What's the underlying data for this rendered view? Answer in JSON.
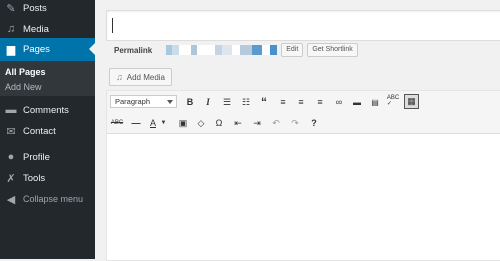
{
  "sidebar": {
    "items": [
      {
        "label": "Posts",
        "icon": "pin-icon"
      },
      {
        "label": "Media",
        "icon": "media-icon"
      },
      {
        "label": "Pages",
        "icon": "pages-icon"
      },
      {
        "label": "Comments",
        "icon": "comments-icon"
      },
      {
        "label": "Contact",
        "icon": "mail-icon"
      },
      {
        "label": "Profile",
        "icon": "user-icon"
      },
      {
        "label": "Tools",
        "icon": "wrench-icon"
      },
      {
        "label": "Collapse menu",
        "icon": "collapse-icon"
      }
    ],
    "submenu": [
      {
        "label": "All Pages"
      },
      {
        "label": "Add New"
      }
    ]
  },
  "editor": {
    "permalink_label": "Permalink",
    "edit_label": "Edit",
    "shortlink_label": "Get Shortlink",
    "add_media_label": "Add Media",
    "format_select_value": "Paragraph"
  },
  "toolbar": {
    "row1": [
      "bold-icon",
      "italic-icon",
      "bullet-list-icon",
      "numbered-list-icon",
      "blockquote-icon",
      "align-left-icon",
      "align-center-icon",
      "align-right-icon",
      "link-icon",
      "read-more-icon",
      "unlink-icon",
      "spellcheck-icon",
      "toolbar-toggle-icon"
    ],
    "row2": [
      "strikethrough-icon",
      "horizontal-line-icon",
      "text-color-icon",
      "paste-text-icon",
      "clear-format-icon",
      "special-char-icon",
      "outdent-icon",
      "indent-icon",
      "undo-icon",
      "redo-icon",
      "help-icon"
    ]
  },
  "colors": {
    "sidebar_bg": "#23282d",
    "active_bg": "#0073aa",
    "submenu_bg": "#32373c"
  }
}
